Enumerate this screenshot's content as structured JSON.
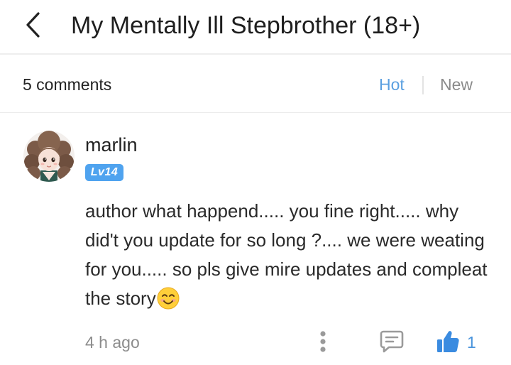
{
  "header": {
    "back_icon": "chevron-left-icon",
    "title": "My Mentally Ill Stepbrother (18+)"
  },
  "comments_bar": {
    "count_label": "5 comments",
    "sort_hot": "Hot",
    "sort_new": "New",
    "active_sort_color": "#5a9fe0"
  },
  "comment": {
    "avatar_icon": "user-avatar",
    "username": "marlin",
    "level": "Lv14",
    "level_color": "#4fa3ef",
    "text": "author what happend..... you fine right..... why did't you update for so long ?.... we were weating for you..... so pls give mire updates and compleat the story",
    "emoji": "smiling-face-emoji",
    "time": "4 h ago",
    "actions": {
      "more_icon": "more-vertical-icon",
      "reply_icon": "comment-icon",
      "like_icon": "thumbs-up-icon",
      "like_count": "1",
      "like_color": "#3a8be0"
    }
  }
}
